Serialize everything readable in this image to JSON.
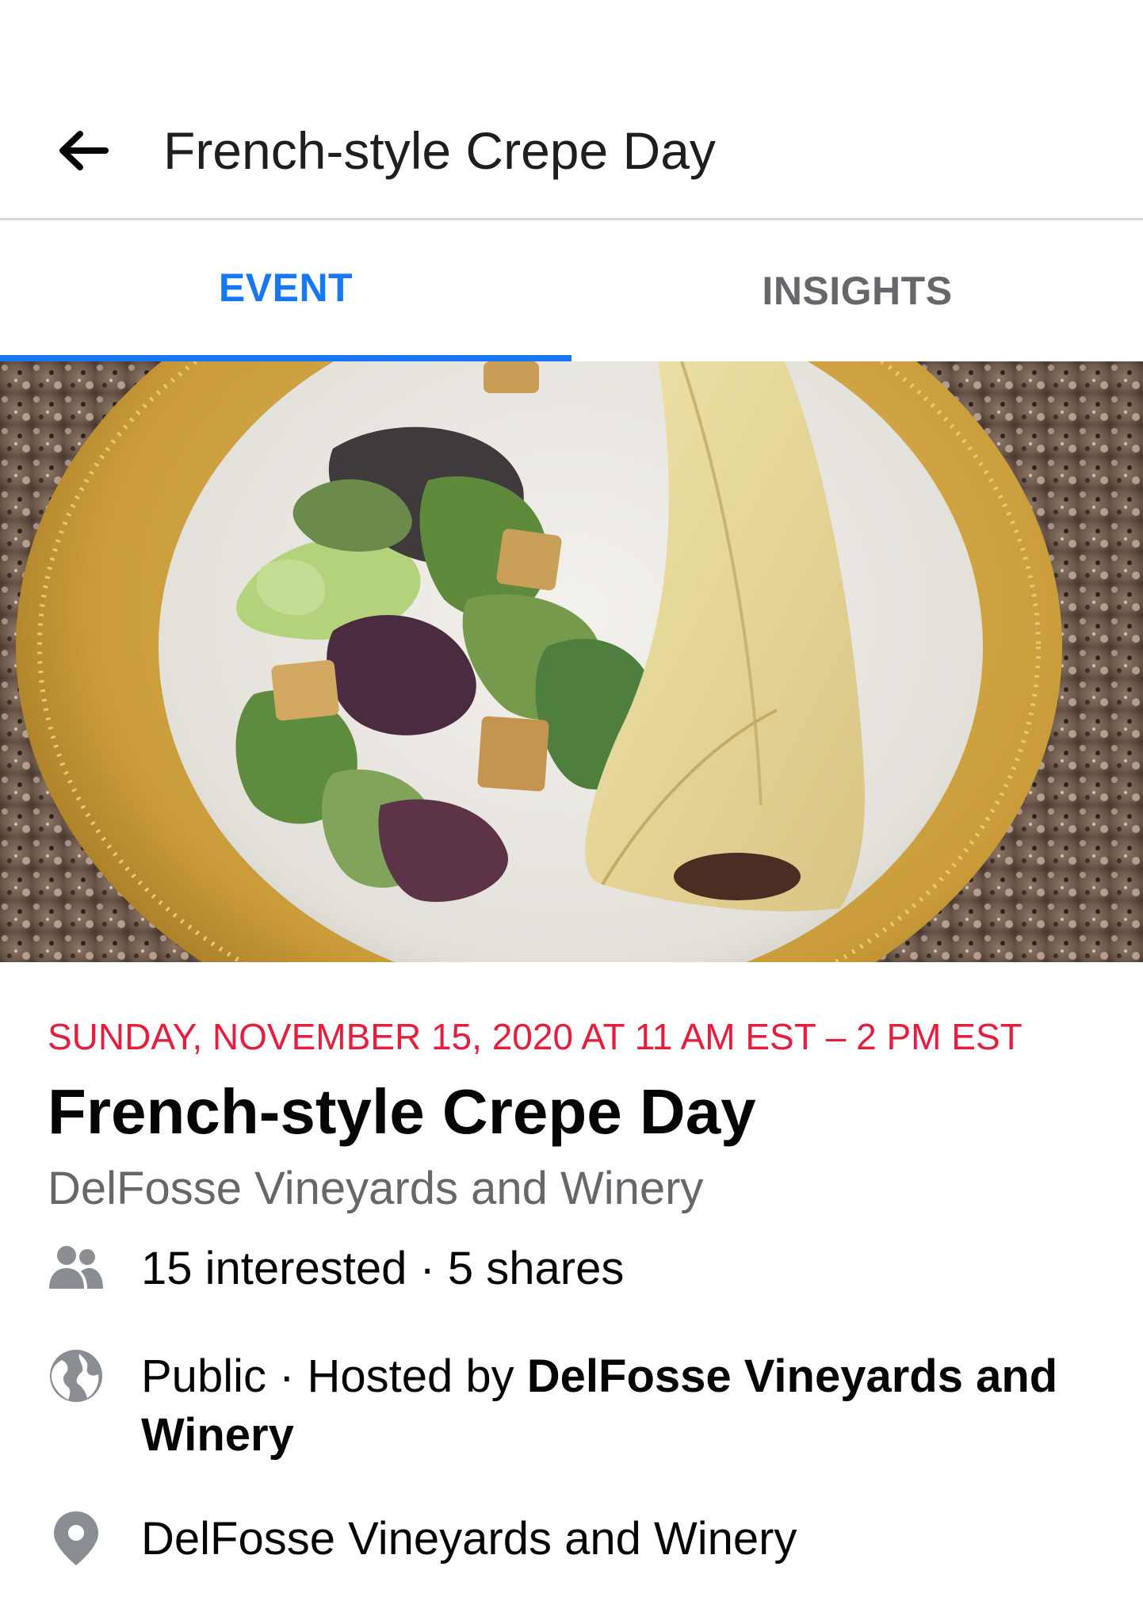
{
  "header": {
    "title": "French-style Crepe Day",
    "back_icon": "arrow-left-icon"
  },
  "tabs": [
    {
      "label": "EVENT",
      "active": true
    },
    {
      "label": "INSIGHTS",
      "active": false
    }
  ],
  "cover": {
    "description_icon": "cover-photo"
  },
  "event": {
    "date": "SUNDAY, NOVEMBER 15, 2020 AT 11 AM EST – 2 PM EST",
    "title": "French-style Crepe Day",
    "host_line": "DelFosse Vineyards and Winery",
    "interest": "15 interested · 5 shares",
    "privacy_prefix": "Public · Hosted by ",
    "privacy_host": "DelFosse Vineyards and Winery",
    "location": "DelFosse Vineyards and Winery"
  },
  "colors": {
    "accent": "#1877f2",
    "date": "#e41e3f",
    "secondary_text": "#65676b",
    "icon_gray": "#8a8d91"
  }
}
